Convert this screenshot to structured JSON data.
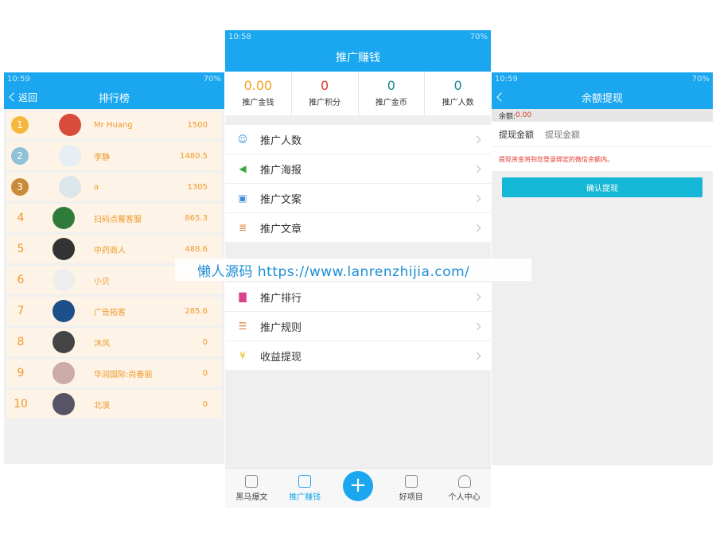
{
  "left": {
    "status": {
      "time": "10:59",
      "battery": "70%"
    },
    "back_label": "返回",
    "title": "排行榜",
    "rows": [
      {
        "rank": "1",
        "name": "Mr Huang",
        "score": "1500",
        "medal_color": "#f6b73c"
      },
      {
        "rank": "2",
        "name": "李静",
        "score": "1480.5",
        "medal_color": "#8fc1d8"
      },
      {
        "rank": "3",
        "name": "a",
        "score": "1305",
        "medal_color": "#c98a3a"
      },
      {
        "rank": "4",
        "name": "扫码点餐客服",
        "score": "865.3"
      },
      {
        "rank": "5",
        "name": "中药商人",
        "score": "488.6"
      },
      {
        "rank": "6",
        "name": "小贝",
        "score": ""
      },
      {
        "rank": "7",
        "name": "广告拓客",
        "score": "285.6"
      },
      {
        "rank": "8",
        "name": "沐风",
        "score": "0"
      },
      {
        "rank": "9",
        "name": "华润国际:尚春丽",
        "score": "0"
      },
      {
        "rank": "10",
        "name": "北漠",
        "score": "0"
      }
    ]
  },
  "middle": {
    "status": {
      "time": "10:58",
      "battery": "70%"
    },
    "title": "推广赚钱",
    "stats": [
      {
        "value": "0.00",
        "label": "推广金钱",
        "color": "#f0a21f"
      },
      {
        "value": "0",
        "label": "推广积分",
        "color": "#e3362d"
      },
      {
        "value": "0",
        "label": "推广金币",
        "color": "#138a8a"
      },
      {
        "value": "0",
        "label": "推广人数",
        "color": "#138a8a"
      }
    ],
    "menu_group1": [
      {
        "label": "推广人数",
        "icon": "person-icon",
        "color": "#3b8ed8"
      },
      {
        "label": "推广海报",
        "icon": "megaphone-icon",
        "color": "#3aa845"
      },
      {
        "label": "推广文案",
        "icon": "copy-icon",
        "color": "#3b8ed8"
      },
      {
        "label": "推广文章",
        "icon": "article-icon",
        "color": "#e0783b"
      }
    ],
    "menu_group2": [
      {
        "label": "推广排行",
        "icon": "ranking-icon",
        "color": "#d8428e"
      },
      {
        "label": "推广规则",
        "icon": "rules-icon",
        "color": "#e0783b"
      },
      {
        "label": "收益提现",
        "icon": "withdraw-icon",
        "color": "#e0c21b"
      }
    ],
    "tabs": [
      {
        "label": "黑马爆文",
        "icon": "document-icon"
      },
      {
        "label": "推广赚钱",
        "icon": "money-bag-icon"
      },
      {
        "label": "+",
        "icon": "plus-icon"
      },
      {
        "label": "好项目",
        "icon": "folder-icon"
      },
      {
        "label": "个人中心",
        "icon": "user-icon"
      }
    ]
  },
  "right": {
    "status": {
      "time": "10:59",
      "battery": "70%"
    },
    "title": "余额提现",
    "balance_label": "余额:",
    "balance_value": "0.00",
    "amount_label": "提现金额",
    "amount_placeholder": "提现金额",
    "tip": "提现资金将到您登录绑定的微信余额内。",
    "confirm_label": "确认提现"
  },
  "watermark": "懒人源码 https://www.lanrenzhijia.com/"
}
